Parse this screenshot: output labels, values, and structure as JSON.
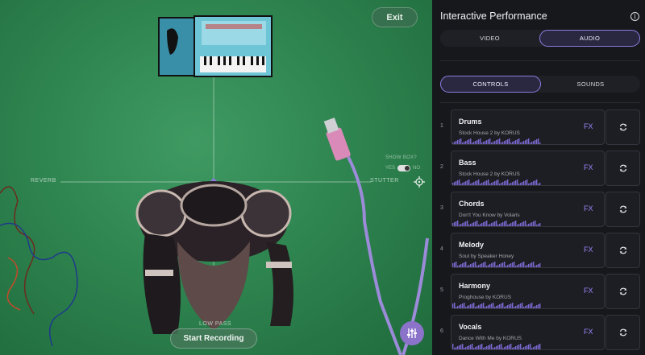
{
  "stage": {
    "exit_label": "Exit",
    "axis_left": "REVERB",
    "axis_right": "STUTTER",
    "axis_bottom": "LOW PASS",
    "show_box_label": "SHOW BOX?",
    "toggle_yes": "YES",
    "toggle_no": "NO",
    "record_label": "Start Recording"
  },
  "panel": {
    "title": "Interactive Performance",
    "media_tabs": [
      {
        "label": "VIDEO",
        "active": false
      },
      {
        "label": "AUDIO",
        "active": true
      }
    ],
    "sub_tabs": [
      {
        "label": "CONTROLS",
        "active": true
      },
      {
        "label": "SOUNDS",
        "active": false
      }
    ],
    "tracks": [
      {
        "num": "1",
        "name": "Drums",
        "sub": "Stock House 2 by KORUS",
        "fx": "FX"
      },
      {
        "num": "2",
        "name": "Bass",
        "sub": "Stock House 2 by KORUS",
        "fx": "FX"
      },
      {
        "num": "3",
        "name": "Chords",
        "sub": "Don't You Know by Volaris",
        "fx": "FX"
      },
      {
        "num": "4",
        "name": "Melody",
        "sub": "Soul by Speaker Honey",
        "fx": "FX"
      },
      {
        "num": "5",
        "name": "Harmony",
        "sub": "Proghouse by KORUS",
        "fx": "FX"
      },
      {
        "num": "6",
        "name": "Vocals",
        "sub": "Dance With Me by KORUS",
        "fx": "FX"
      }
    ]
  },
  "colors": {
    "accent": "#8c7be0",
    "fx": "#9c86ff",
    "stage_green": "#2f8550",
    "panel_bg": "#17181c"
  },
  "icons": [
    "info-icon",
    "crosshair-icon",
    "mixer-sliders-icon",
    "swap-arrows-icon"
  ]
}
